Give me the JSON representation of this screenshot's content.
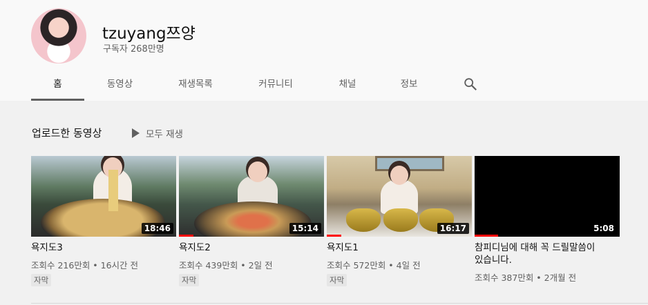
{
  "channel": {
    "name": "tzuyang쯔양",
    "subscribers": "구독자 268만명"
  },
  "tabs": [
    {
      "label": "홈"
    },
    {
      "label": "동영상"
    },
    {
      "label": "재생목록"
    },
    {
      "label": "커뮤니티"
    },
    {
      "label": "채널"
    },
    {
      "label": "정보"
    }
  ],
  "section": {
    "title": "업로드한 동영상",
    "play_all": "모두 재생"
  },
  "videos": [
    {
      "title": "욕지도3",
      "meta": "조회수 216만회 • 16시간 전",
      "duration": "18:46",
      "badge": "자막",
      "watched_fraction": 0
    },
    {
      "title": "욕지도2",
      "meta": "조회수 439만회 • 2일 전",
      "duration": "15:14",
      "badge": "자막",
      "watched_fraction": 0.1
    },
    {
      "title": "욕지도1",
      "meta": "조회수 572만회 • 4일 전",
      "duration": "16:17",
      "badge": "자막",
      "watched_fraction": 0.1
    },
    {
      "title": "참피디님에 대해 꼭 드릴말씀이 있습니다.",
      "meta": "조회수 387만회 • 2개월 전",
      "duration": "5:08",
      "badge": "",
      "watched_fraction": 0.16
    }
  ],
  "icons": {
    "search": "search-icon",
    "play": "play-icon"
  }
}
